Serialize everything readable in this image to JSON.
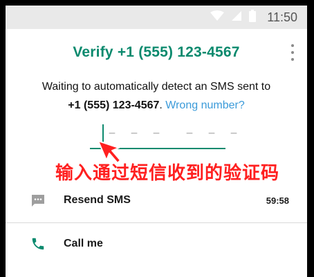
{
  "status_bar": {
    "time": "11:50",
    "icons": [
      "wifi-icon",
      "signal-icon",
      "battery-icon"
    ]
  },
  "header": {
    "title": "Verify +1 (555) 123-4567",
    "menu_icon": "overflow-menu-icon"
  },
  "instructions": {
    "line1": "Waiting to automatically detect an SMS sent to",
    "phone": "+1 (555) 123-4567",
    "period": ". ",
    "wrong_number_link": "Wrong number?"
  },
  "code_input": {
    "placeholder": "– – –  – – –",
    "value": ""
  },
  "annotation": {
    "text": "输入通过短信收到的验证码",
    "color": "#ff2020"
  },
  "options": {
    "resend": {
      "label": "Resend SMS",
      "timer": "59:58",
      "icon": "message-icon"
    },
    "call": {
      "label": "Call me",
      "icon": "phone-icon"
    }
  },
  "colors": {
    "accent": "#0b8a6e",
    "link": "#3a9ad9"
  }
}
